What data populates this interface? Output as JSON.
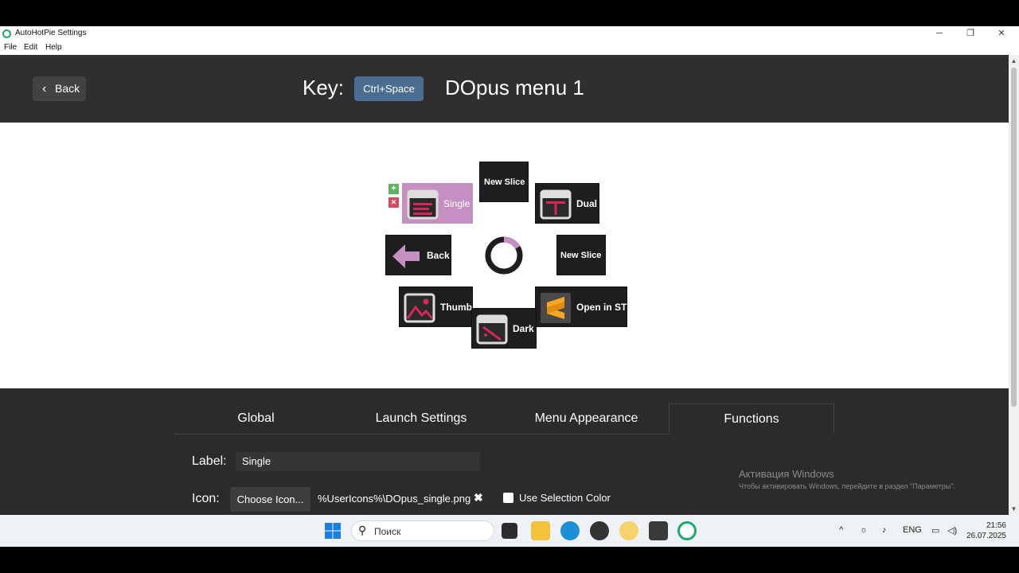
{
  "window": {
    "title": "AutoHotPie Settings",
    "minimize": "─",
    "maximize": "❐",
    "close": "✕"
  },
  "menubar": [
    "File",
    "Edit",
    "Help"
  ],
  "header": {
    "back_label": "Back",
    "key_label": "Key:",
    "hotkey": "Ctrl+Space",
    "menu_name": "DOpus menu 1"
  },
  "preview": {
    "slices": [
      {
        "label": "New Slice",
        "icon": null
      },
      {
        "label": "Single",
        "icon": "window-single-icon",
        "selected": true
      },
      {
        "label": "Dual",
        "icon": "window-dual-icon"
      },
      {
        "label": "Back",
        "icon": "arrow-left-icon"
      },
      {
        "label": "New Slice",
        "icon": null
      },
      {
        "label": "Thumb",
        "icon": "image-icon"
      },
      {
        "label": "Dark",
        "icon": "window-dark-icon"
      },
      {
        "label": "Open in ST",
        "icon": "sublime-text-icon"
      }
    ],
    "add_glyph": "+",
    "remove_glyph": "✕"
  },
  "tabs": [
    "Global",
    "Launch Settings",
    "Menu Appearance",
    "Functions"
  ],
  "active_tab": "Functions",
  "form": {
    "label_caption": "Label:",
    "label_value": "Single",
    "icon_caption": "Icon:",
    "choose_icon": "Choose Icon...",
    "icon_path": "%UserIcons%\\DOpus_single.png",
    "clear_glyph": "✖",
    "use_selection_color": "Use Selection Color"
  },
  "activation": {
    "title": "Активация Windows",
    "subtitle": "Чтобы активировать Windows, перейдите в раздел \"Параметры\"."
  },
  "taskbar": {
    "search_placeholder": "Поиск",
    "language": "ENG",
    "time": "21:56",
    "date": "26.07.2025"
  },
  "colors": {
    "accent_pink": "#c58fc1",
    "slice_bg": "#1e1e1e",
    "hotkey_blue": "#4a6d91",
    "icon_red": "#d6265a"
  }
}
